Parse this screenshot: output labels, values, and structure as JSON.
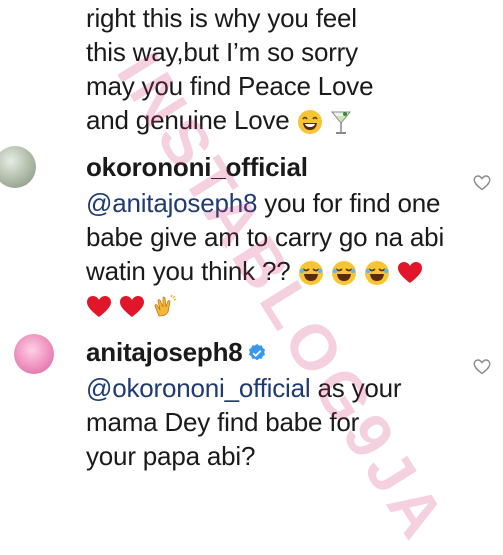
{
  "comment_top": {
    "lines": [
      "right this is why you feel",
      "this way,but I’m so sorry",
      "may you find Peace Love",
      "and genuine Love"
    ]
  },
  "comment_reply1": {
    "username": "okorononi_official",
    "mention": "@anitajoseph8",
    "line1_rest": " you for find one",
    "line2": "babe give am to carry go na abi",
    "line3": "watin you think ??"
  },
  "comment_reply2": {
    "username": "anitajoseph8",
    "mention": "@okorononi_official",
    "line1_rest": " as your",
    "line2": "mama Dey find babe for",
    "line3": "your papa abi?"
  },
  "watermark": "INSTABLOG9JA",
  "icons": [
    "heart-outline-icon",
    "verified-badge-icon",
    "laughing-emoji-icon",
    "red-heart-emoji-icon",
    "clapping-emoji-icon",
    "cocktail-emoji-icon"
  ]
}
